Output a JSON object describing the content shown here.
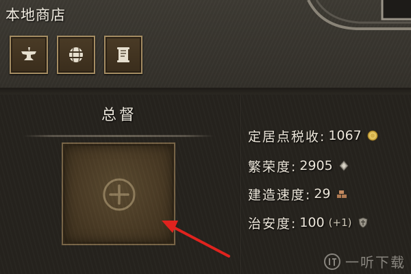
{
  "shop": {
    "title": "本地商店",
    "tabs": [
      {
        "icon": "anvil-icon"
      },
      {
        "icon": "barrel-icon"
      },
      {
        "icon": "scroll-icon"
      }
    ]
  },
  "governor": {
    "title": "总督",
    "slot_icon": "add-icon"
  },
  "stats": [
    {
      "label": "定居点税收:",
      "value": "1067",
      "bonus": "",
      "icon": "gold-coin-icon"
    },
    {
      "label": "繁荣度:",
      "value": "2905",
      "bonus": "",
      "icon": "prosperity-icon"
    },
    {
      "label": "建造速度:",
      "value": "29",
      "bonus": "",
      "icon": "bricks-icon"
    },
    {
      "label": "治安度:",
      "value": "100",
      "bonus": "(+1)",
      "icon": "shield-icon"
    }
  ],
  "watermark": {
    "text": "一听下载"
  },
  "colors": {
    "gold": "#d6b24a",
    "panel_dark": "#26231e",
    "panel_light": "#3a372f",
    "slot_frame": "#7a6648",
    "arrow": "#e0231e"
  }
}
